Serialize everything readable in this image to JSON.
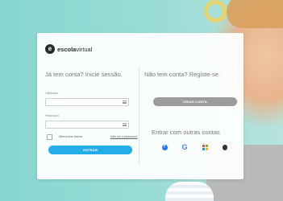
{
  "brand": {
    "mark": "e",
    "name_bold": "escola",
    "name_light": "virtual"
  },
  "login": {
    "title": "Já tem conta? Inicie sessão.",
    "username_label": "Utilizador",
    "username_value": "",
    "password_label": "Password",
    "password_value": "",
    "remember_label": "Memorizar dados",
    "forgot_label": "Não sei a password",
    "submit_label": "ENTRAR"
  },
  "register": {
    "title": "Não tem conta? Registe-se.",
    "create_label": "CRIAR CONTA"
  },
  "social": {
    "title": "Entrar com outras contas",
    "providers": [
      {
        "name": "facebook",
        "icon": "facebook-icon",
        "glyph": "f"
      },
      {
        "name": "google",
        "icon": "google-icon",
        "glyph": "G"
      },
      {
        "name": "microsoft",
        "icon": "microsoft-icon"
      },
      {
        "name": "apple",
        "icon": "apple-icon",
        "glyph": ""
      }
    ]
  },
  "colors": {
    "accent": "#24aee8",
    "secondary_button": "#9c9c9c",
    "background": "#7fd4cf"
  }
}
